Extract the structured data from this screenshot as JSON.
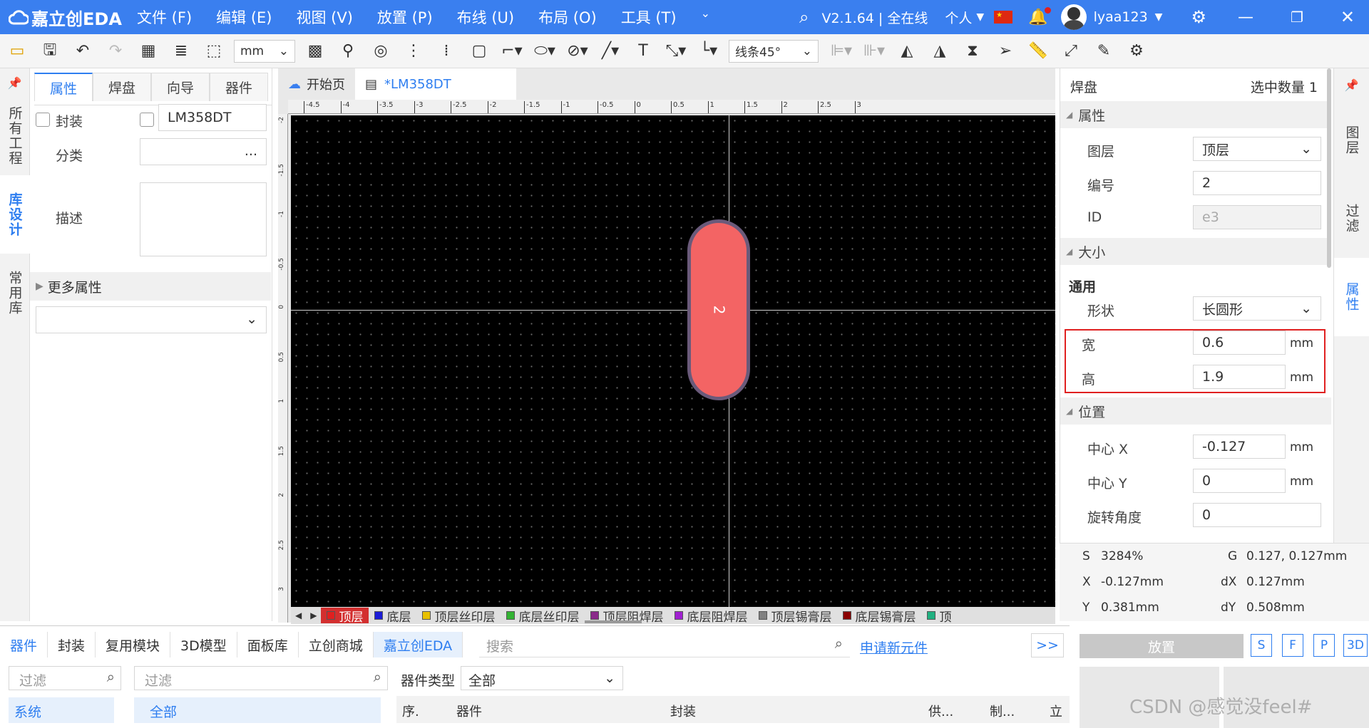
{
  "titlebar": {
    "app_name": "嘉立创EDA",
    "menus": [
      "文件 (F)",
      "编辑 (E)",
      "视图 (V)",
      "放置 (P)",
      "布线 (U)",
      "布局 (O)",
      "工具 (T)"
    ],
    "version": "V2.1.64 | 全在线",
    "workspace": "个人",
    "username": "lyaa123"
  },
  "toolbar": {
    "unit": "mm",
    "line_mode": "线条45°"
  },
  "left_vtabs": [
    "所有工程",
    "库设计",
    "常用库"
  ],
  "left_panel": {
    "tabs": [
      "属性",
      "焊盘",
      "向导",
      "器件"
    ],
    "footprint_label": "封装",
    "footprint_value": "LM358DT",
    "category_label": "分类",
    "category_value": "...",
    "description_label": "描述",
    "more_props": "更多属性"
  },
  "doc_tabs": [
    {
      "label": "开始页",
      "active": false
    },
    {
      "label": "*LM358DT",
      "active": true
    }
  ],
  "canvas": {
    "pad_number": "2",
    "h_ticks": [
      "-4.5",
      "-4",
      "-3.5",
      "-3",
      "-2.5",
      "-2",
      "-1.5",
      "-1",
      "-0.5",
      "0",
      "0.5",
      "1",
      "1.5",
      "2",
      "2.5",
      "3"
    ],
    "v_ticks": [
      "-2",
      "-1.5",
      "-1",
      "-0.5",
      "0",
      "0.5",
      "1",
      "1.5",
      "2",
      "2.5",
      "3"
    ]
  },
  "layers": [
    {
      "name": "顶层",
      "color": "#e02020",
      "active": true
    },
    {
      "name": "底层",
      "color": "#1c1cd6",
      "active": false
    },
    {
      "name": "顶层丝印层",
      "color": "#e8c000",
      "active": false
    },
    {
      "name": "底层丝印层",
      "color": "#33b333",
      "active": false
    },
    {
      "name": "顶层阻焊层",
      "color": "#8a2a8a",
      "active": false
    },
    {
      "name": "底层阻焊层",
      "color": "#a020d0",
      "active": false
    },
    {
      "name": "顶层锡膏层",
      "color": "#808080",
      "active": false
    },
    {
      "name": "底层锡膏层",
      "color": "#8a0000",
      "active": false
    },
    {
      "name": "顶",
      "color": "#20b080",
      "active": false
    }
  ],
  "right_panel": {
    "title": "焊盘",
    "selected_count": "选中数量  1",
    "section_props": "属性",
    "layer_label": "图层",
    "layer_value": "顶层",
    "number_label": "编号",
    "number_value": "2",
    "id_label": "ID",
    "id_value": "e3",
    "section_size": "大小",
    "general_label": "通用",
    "shape_label": "形状",
    "shape_value": "长圆形",
    "width_label": "宽",
    "width_value": "0.6",
    "height_label": "高",
    "height_value": "1.9",
    "unit": "mm",
    "section_pos": "位置",
    "cx_label": "中心 X",
    "cx_value": "-0.127",
    "cy_label": "中心 Y",
    "cy_value": "0",
    "rot_label": "旋转角度",
    "rot_value": "0"
  },
  "right_vtabs": [
    "图层",
    "过滤",
    "属性"
  ],
  "status": {
    "s_label": "S",
    "s_value": "3284%",
    "g_label": "G",
    "g_value": "0.127, 0.127mm",
    "x_label": "X",
    "x_value": "-0.127mm",
    "dx_label": "dX",
    "dx_value": "0.127mm",
    "y_label": "Y",
    "y_value": "0.381mm",
    "dy_label": "dY",
    "dy_value": "0.508mm"
  },
  "bottom": {
    "tabs": [
      "器件",
      "封装",
      "复用模块",
      "3D模型",
      "面板库",
      "立创商城",
      "嘉立创EDA"
    ],
    "search_placeholder": "搜索",
    "apply_link": "申请新元件",
    "expand": ">>",
    "filter1_placeholder": "过滤",
    "filter2_placeholder": "过滤",
    "type_label": "器件类型",
    "type_value": "全部",
    "tree1": "系统",
    "tree2": "全部",
    "columns": [
      "序.",
      "器件",
      "封装",
      "供...",
      "制...",
      "立"
    ],
    "place_btn": "放置",
    "quick_btns": [
      "S",
      "F",
      "P",
      "3D"
    ],
    "watermark": "CSDN @感觉没feel#"
  },
  "colors": {
    "accent": "#3a7fef",
    "pad_fill": "#f36464",
    "highlight_border": "#e02020"
  }
}
